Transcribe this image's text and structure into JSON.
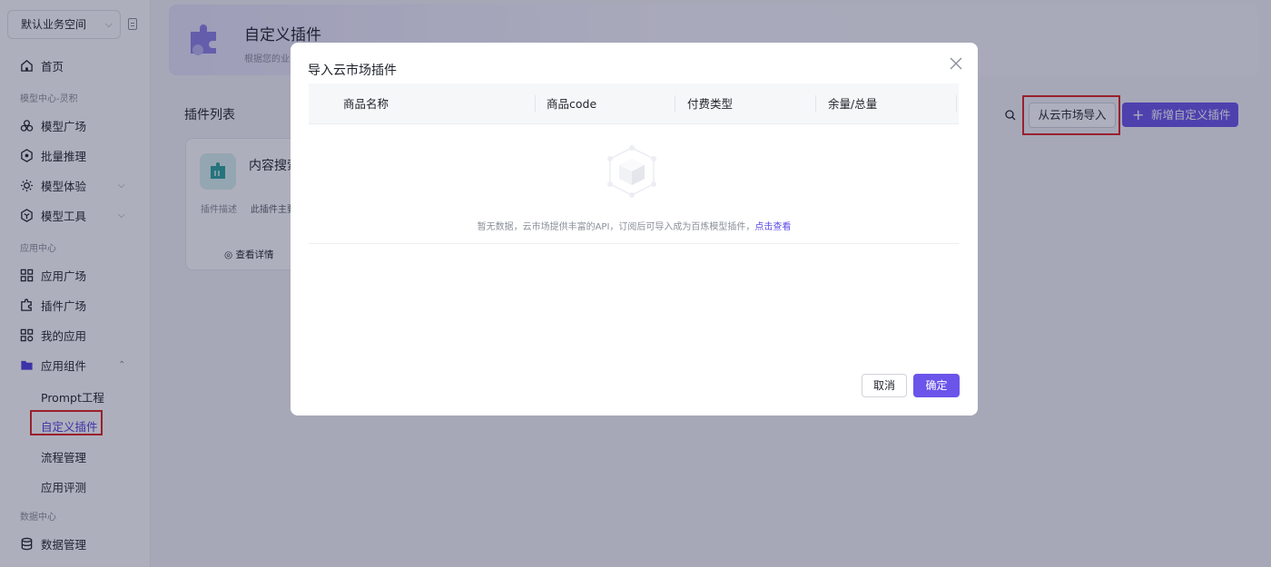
{
  "sidebar": {
    "workspace": "默认业务空间",
    "items": {
      "home": "首页",
      "model_plaza": "模型广场",
      "batch_infer": "批量推理",
      "model_exp": "模型体验",
      "model_tools": "模型工具",
      "app_plaza": "应用广场",
      "plugin_plaza": "插件广场",
      "my_apps": "我的应用",
      "app_components": "应用组件",
      "data_manage": "数据管理"
    },
    "sections": {
      "model_center": "模型中心-灵积",
      "app_center": "应用中心",
      "data_center": "数据中心"
    },
    "sub_items": {
      "prompt": "Prompt工程",
      "custom_plugin": "自定义插件",
      "flow": "流程管理",
      "eval": "应用评测"
    }
  },
  "main": {
    "banner_title": "自定义插件",
    "banner_sub": "根据您的业",
    "list_title": "插件列表",
    "import_btn": "从云市场导入",
    "add_btn": "新增自定义插件",
    "card": {
      "title": "内容搜索",
      "desc_label": "插件描述",
      "desc": "此插件主要",
      "detail": "查看详情"
    }
  },
  "modal": {
    "title": "导入云市场插件",
    "columns": [
      "商品名称",
      "商品code",
      "付费类型",
      "余量/总量"
    ],
    "empty_text": "暂无数据，云市场提供丰富的API，订阅后可导入成为百炼模型插件，",
    "empty_link": "点击查看",
    "cancel": "取消",
    "ok": "确定"
  },
  "colors": {
    "accent": "#6a54ea",
    "highlight": "#e02020"
  }
}
